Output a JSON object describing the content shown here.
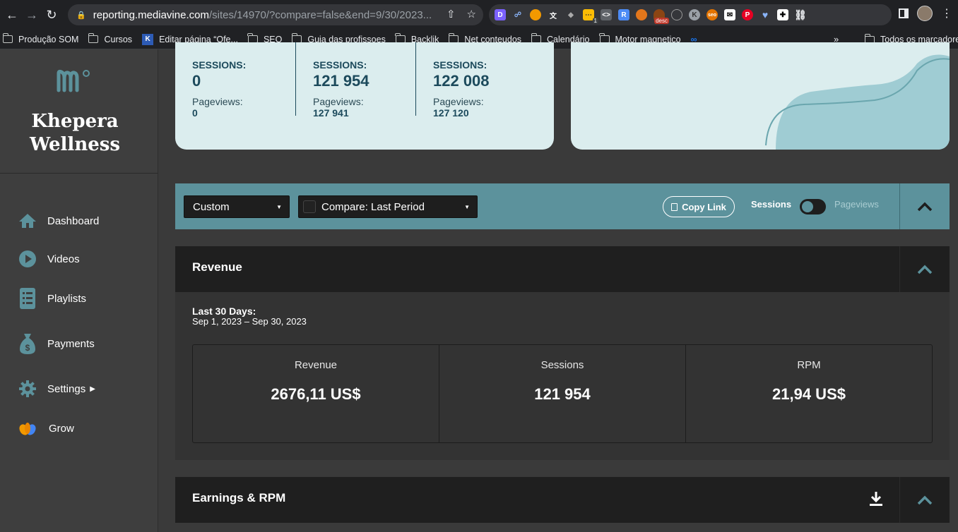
{
  "browser": {
    "url_host": "reporting.mediavine.com",
    "url_path": "/sites/14970/?compare=false&end=9/30/2023...",
    "ext_desc_label": "desc",
    "ext_badge": "1",
    "bookmarks": [
      "Produção SOM",
      "Cursos",
      "Editar página “Ofe...",
      "SEO",
      "Guia das profissoes",
      "Backlik",
      "Net conteudos",
      "Calendário",
      "Motor magnetico"
    ],
    "bookmarks_more": "»",
    "all_bookmarks": "Todos os marcadores"
  },
  "sidebar": {
    "brand_line1": "Khepera",
    "brand_line2": "Wellness",
    "items": [
      {
        "label": "Dashboard",
        "icon": "home-icon"
      },
      {
        "label": "Videos",
        "icon": "play-icon"
      },
      {
        "label": "Playlists",
        "icon": "list-icon"
      },
      {
        "label": "Payments",
        "icon": "money-bag-icon"
      },
      {
        "label": "Settings",
        "icon": "gear-icon"
      },
      {
        "label": "Grow",
        "icon": "grow-logo-icon"
      }
    ],
    "accent": "#5c929c"
  },
  "summary": {
    "columns": [
      {
        "sessions_label": "SESSIONS:",
        "sessions": "0",
        "pageviews_label": "Pageviews:",
        "pageviews": "0"
      },
      {
        "sessions_label": "SESSIONS:",
        "sessions": "121 954",
        "pageviews_label": "Pageviews:",
        "pageviews": "127 941"
      },
      {
        "sessions_label": "SESSIONS:",
        "sessions": "122 008",
        "pageviews_label": "Pageviews:",
        "pageviews": "127 120"
      }
    ]
  },
  "filters": {
    "range_select": "Custom",
    "compare_select": "Compare: Last Period",
    "copy_link": "Copy Link",
    "toggle_left": "Sessions",
    "toggle_right": "Pageviews"
  },
  "revenue": {
    "title": "Revenue",
    "period_title": "Last 30 Days:",
    "period_range": "Sep 1, 2023 – Sep 30, 2023",
    "kpis": [
      {
        "label": "Revenue",
        "value": "2676,11 US$"
      },
      {
        "label": "Sessions",
        "value": "121 954"
      },
      {
        "label": "RPM",
        "value": "21,94 US$"
      }
    ]
  },
  "earnings": {
    "title": "Earnings & RPM"
  }
}
